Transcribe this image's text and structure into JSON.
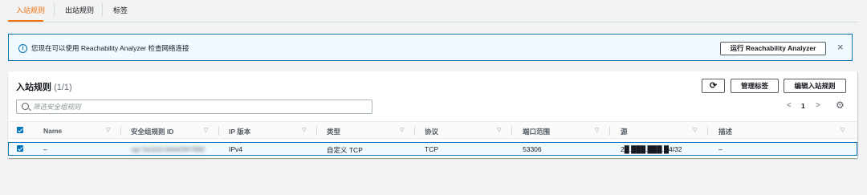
{
  "tabs": [
    {
      "label": "入站规则"
    },
    {
      "label": "出站规则"
    },
    {
      "label": "标签"
    }
  ],
  "banner": {
    "message": "您现在可以使用 Reachability Analyzer 检查网络连接",
    "button_label": "运行 Reachability Analyzer",
    "close_icon": "×",
    "info_icon": "i"
  },
  "rules_panel": {
    "title": "入站规则",
    "count": "(1/1)",
    "refresh_icon": "⟳",
    "manage_tags_label": "管理标签",
    "edit_rules_label": "编辑入站规则",
    "search_placeholder": "筛选安全组规则",
    "pagination": {
      "prev": "<",
      "current": "1",
      "next": ">"
    },
    "settings_icon": "⚙"
  },
  "table": {
    "columns": [
      "Name",
      "安全组规则 ID",
      "IP 版本",
      "类型",
      "协议",
      "端口范围",
      "源",
      "描述"
    ],
    "sort_icon": "▽",
    "rows": [
      {
        "name": "–",
        "rule_id": "sgr-0a1b2c3d4e5f67890",
        "ip_version": "IPv4",
        "type": "自定义 TCP",
        "protocol": "TCP",
        "port_range": "53306",
        "source": "2█.███.███.█4/32",
        "description": "–"
      }
    ]
  },
  "colors": {
    "accent": "#ec7211",
    "info": "#0073bb",
    "selected_row_bg": "#f1faff"
  }
}
